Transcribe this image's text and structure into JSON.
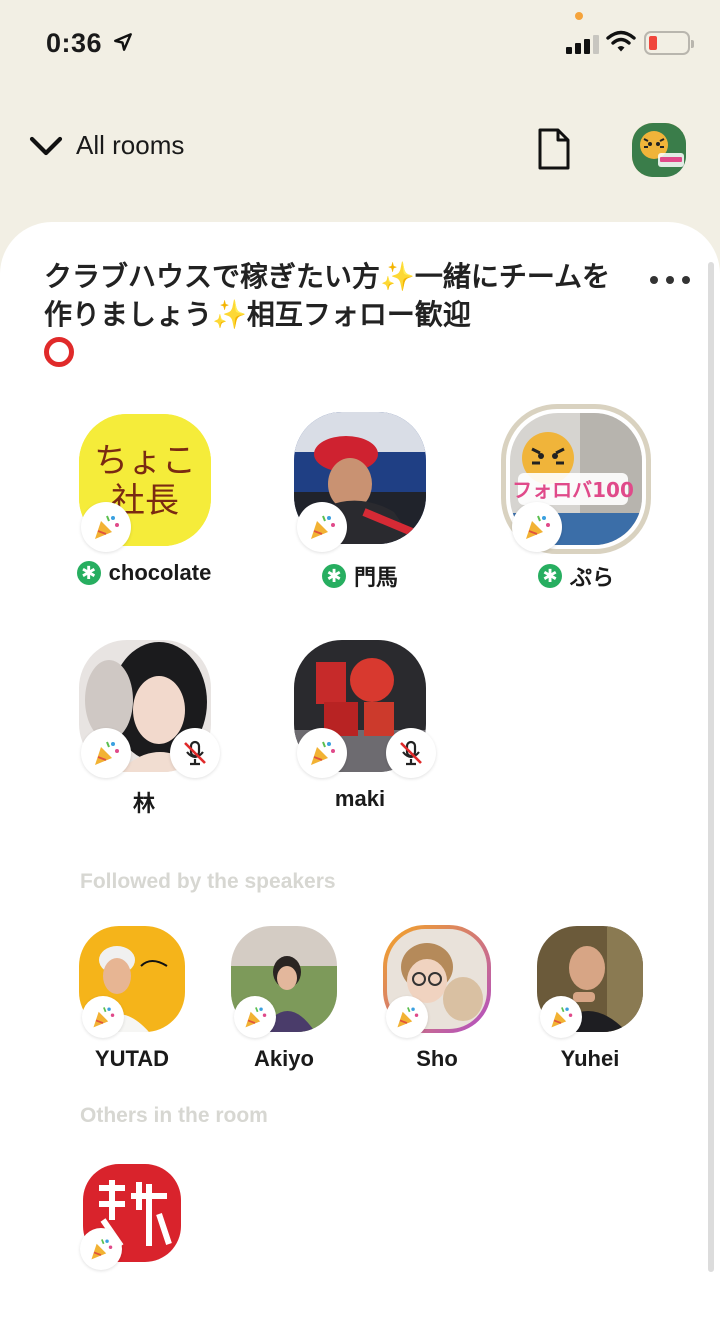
{
  "status_bar": {
    "time": "0:36"
  },
  "nav": {
    "all_rooms_label": "All rooms"
  },
  "room": {
    "title": "クラブハウスで稼ぎたい方✨一緒にチームを作りましょう✨相互フォロー歓迎"
  },
  "speakers": [
    {
      "name": "chocolate",
      "moderator": true,
      "muted": false,
      "avatar_text": "ちょこ社長"
    },
    {
      "name": "門馬",
      "moderator": true,
      "muted": false
    },
    {
      "name": "ぷら",
      "moderator": true,
      "muted": false,
      "avatar_text": "フォロバ100"
    },
    {
      "name": "林",
      "moderator": false,
      "muted": true
    },
    {
      "name": "maki",
      "moderator": false,
      "muted": true
    }
  ],
  "sections": {
    "followed_label": "Followed by the speakers",
    "others_label": "Others in the room"
  },
  "followed": [
    {
      "name": "YUTAD"
    },
    {
      "name": "Akiyo"
    },
    {
      "name": "Sho"
    },
    {
      "name": "Yuhei"
    }
  ],
  "colors": {
    "background": "#f2efe4",
    "moderator_green": "#27ae60",
    "battery_red": "#f0463c"
  }
}
